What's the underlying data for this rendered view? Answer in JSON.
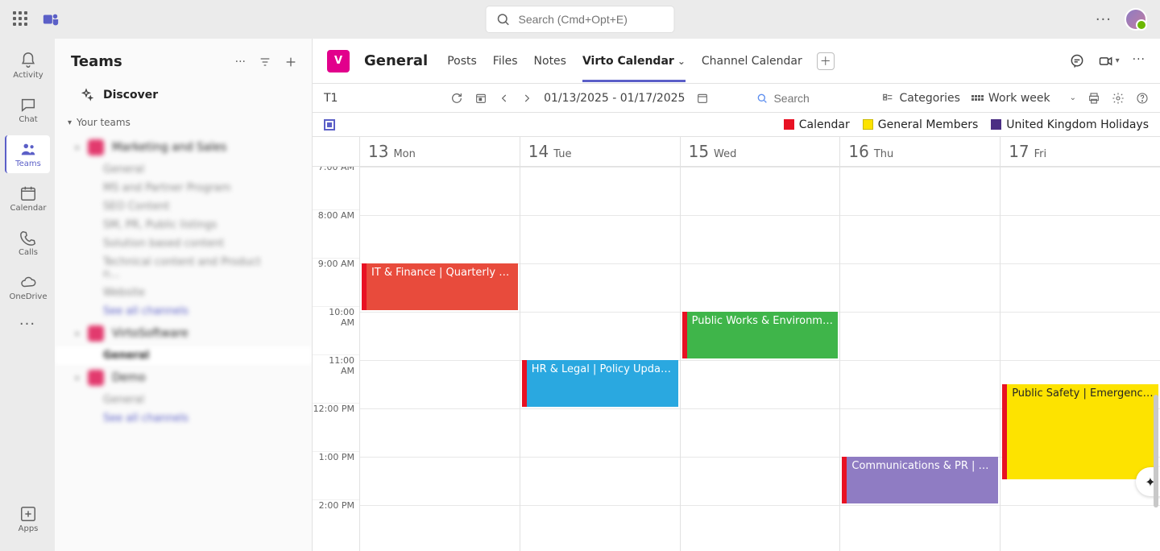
{
  "search_placeholder": "Search (Cmd+Opt+E)",
  "rail": {
    "activity": "Activity",
    "chat": "Chat",
    "teams": "Teams",
    "calendar": "Calendar",
    "calls": "Calls",
    "onedrive": "OneDrive",
    "apps": "Apps"
  },
  "sidebar": {
    "title": "Teams",
    "discover": "Discover",
    "your_teams": "Your teams",
    "teams": [
      {
        "name": "Marketing and Sales",
        "channels": [
          "General",
          "MS and Partner Program",
          "SEO Content",
          "SM, PR, Public listings",
          "Solution based content",
          "Technical content and Product n...",
          "Website",
          "See all channels"
        ]
      },
      {
        "name": "VirtoSoftware",
        "channels": [
          "General"
        ]
      },
      {
        "name": "Demo",
        "channels": [
          "General",
          "See all channels"
        ]
      }
    ]
  },
  "channel": {
    "badge": "V",
    "title": "General",
    "tabs": [
      "Posts",
      "Files",
      "Notes",
      "Virto Calendar",
      "Channel Calendar"
    ],
    "active_tab": 3
  },
  "toolbar": {
    "name": "T1",
    "date_range": "01/13/2025 - 01/17/2025",
    "search_placeholder": "Search",
    "categories": "Categories",
    "view": "Work week"
  },
  "legend": [
    {
      "label": "Calendar",
      "color": "#e81123"
    },
    {
      "label": "General Members",
      "color": "#fde300",
      "border": "#c9b900"
    },
    {
      "label": "United Kingdom Holidays",
      "color": "#4b2e83"
    }
  ],
  "days": [
    {
      "num": "13",
      "name": "Mon"
    },
    {
      "num": "14",
      "name": "Tue"
    },
    {
      "num": "15",
      "name": "Wed"
    },
    {
      "num": "16",
      "name": "Thu"
    },
    {
      "num": "17",
      "name": "Fri"
    }
  ],
  "hours": [
    "7:00 AM",
    "8:00 AM",
    "9:00 AM",
    "10:00 AM",
    "11:00 AM",
    "12:00 PM",
    "1:00 PM",
    "2:00 PM"
  ],
  "events": [
    {
      "day": 0,
      "start": "9:00",
      "end": "10:00",
      "title": "IT & Finance | Quarterly B...",
      "bg": "#e84b3c"
    },
    {
      "day": 1,
      "start": "11:00",
      "end": "12:00",
      "title": "HR & Legal | Policy Updat...",
      "bg": "#2aa8e0"
    },
    {
      "day": 2,
      "start": "10:00",
      "end": "11:00",
      "title": "Public Works & Environme...",
      "bg": "#3fb54a"
    },
    {
      "day": 3,
      "start": "13:00",
      "end": "14:00",
      "title": "Communications & PR | Pr...",
      "bg": "#8f7cc3"
    },
    {
      "day": 4,
      "start": "11:30",
      "end": "13:30",
      "title": "Public Safety | Emergency ...",
      "bg": "#fde300",
      "text": "#242424"
    }
  ]
}
